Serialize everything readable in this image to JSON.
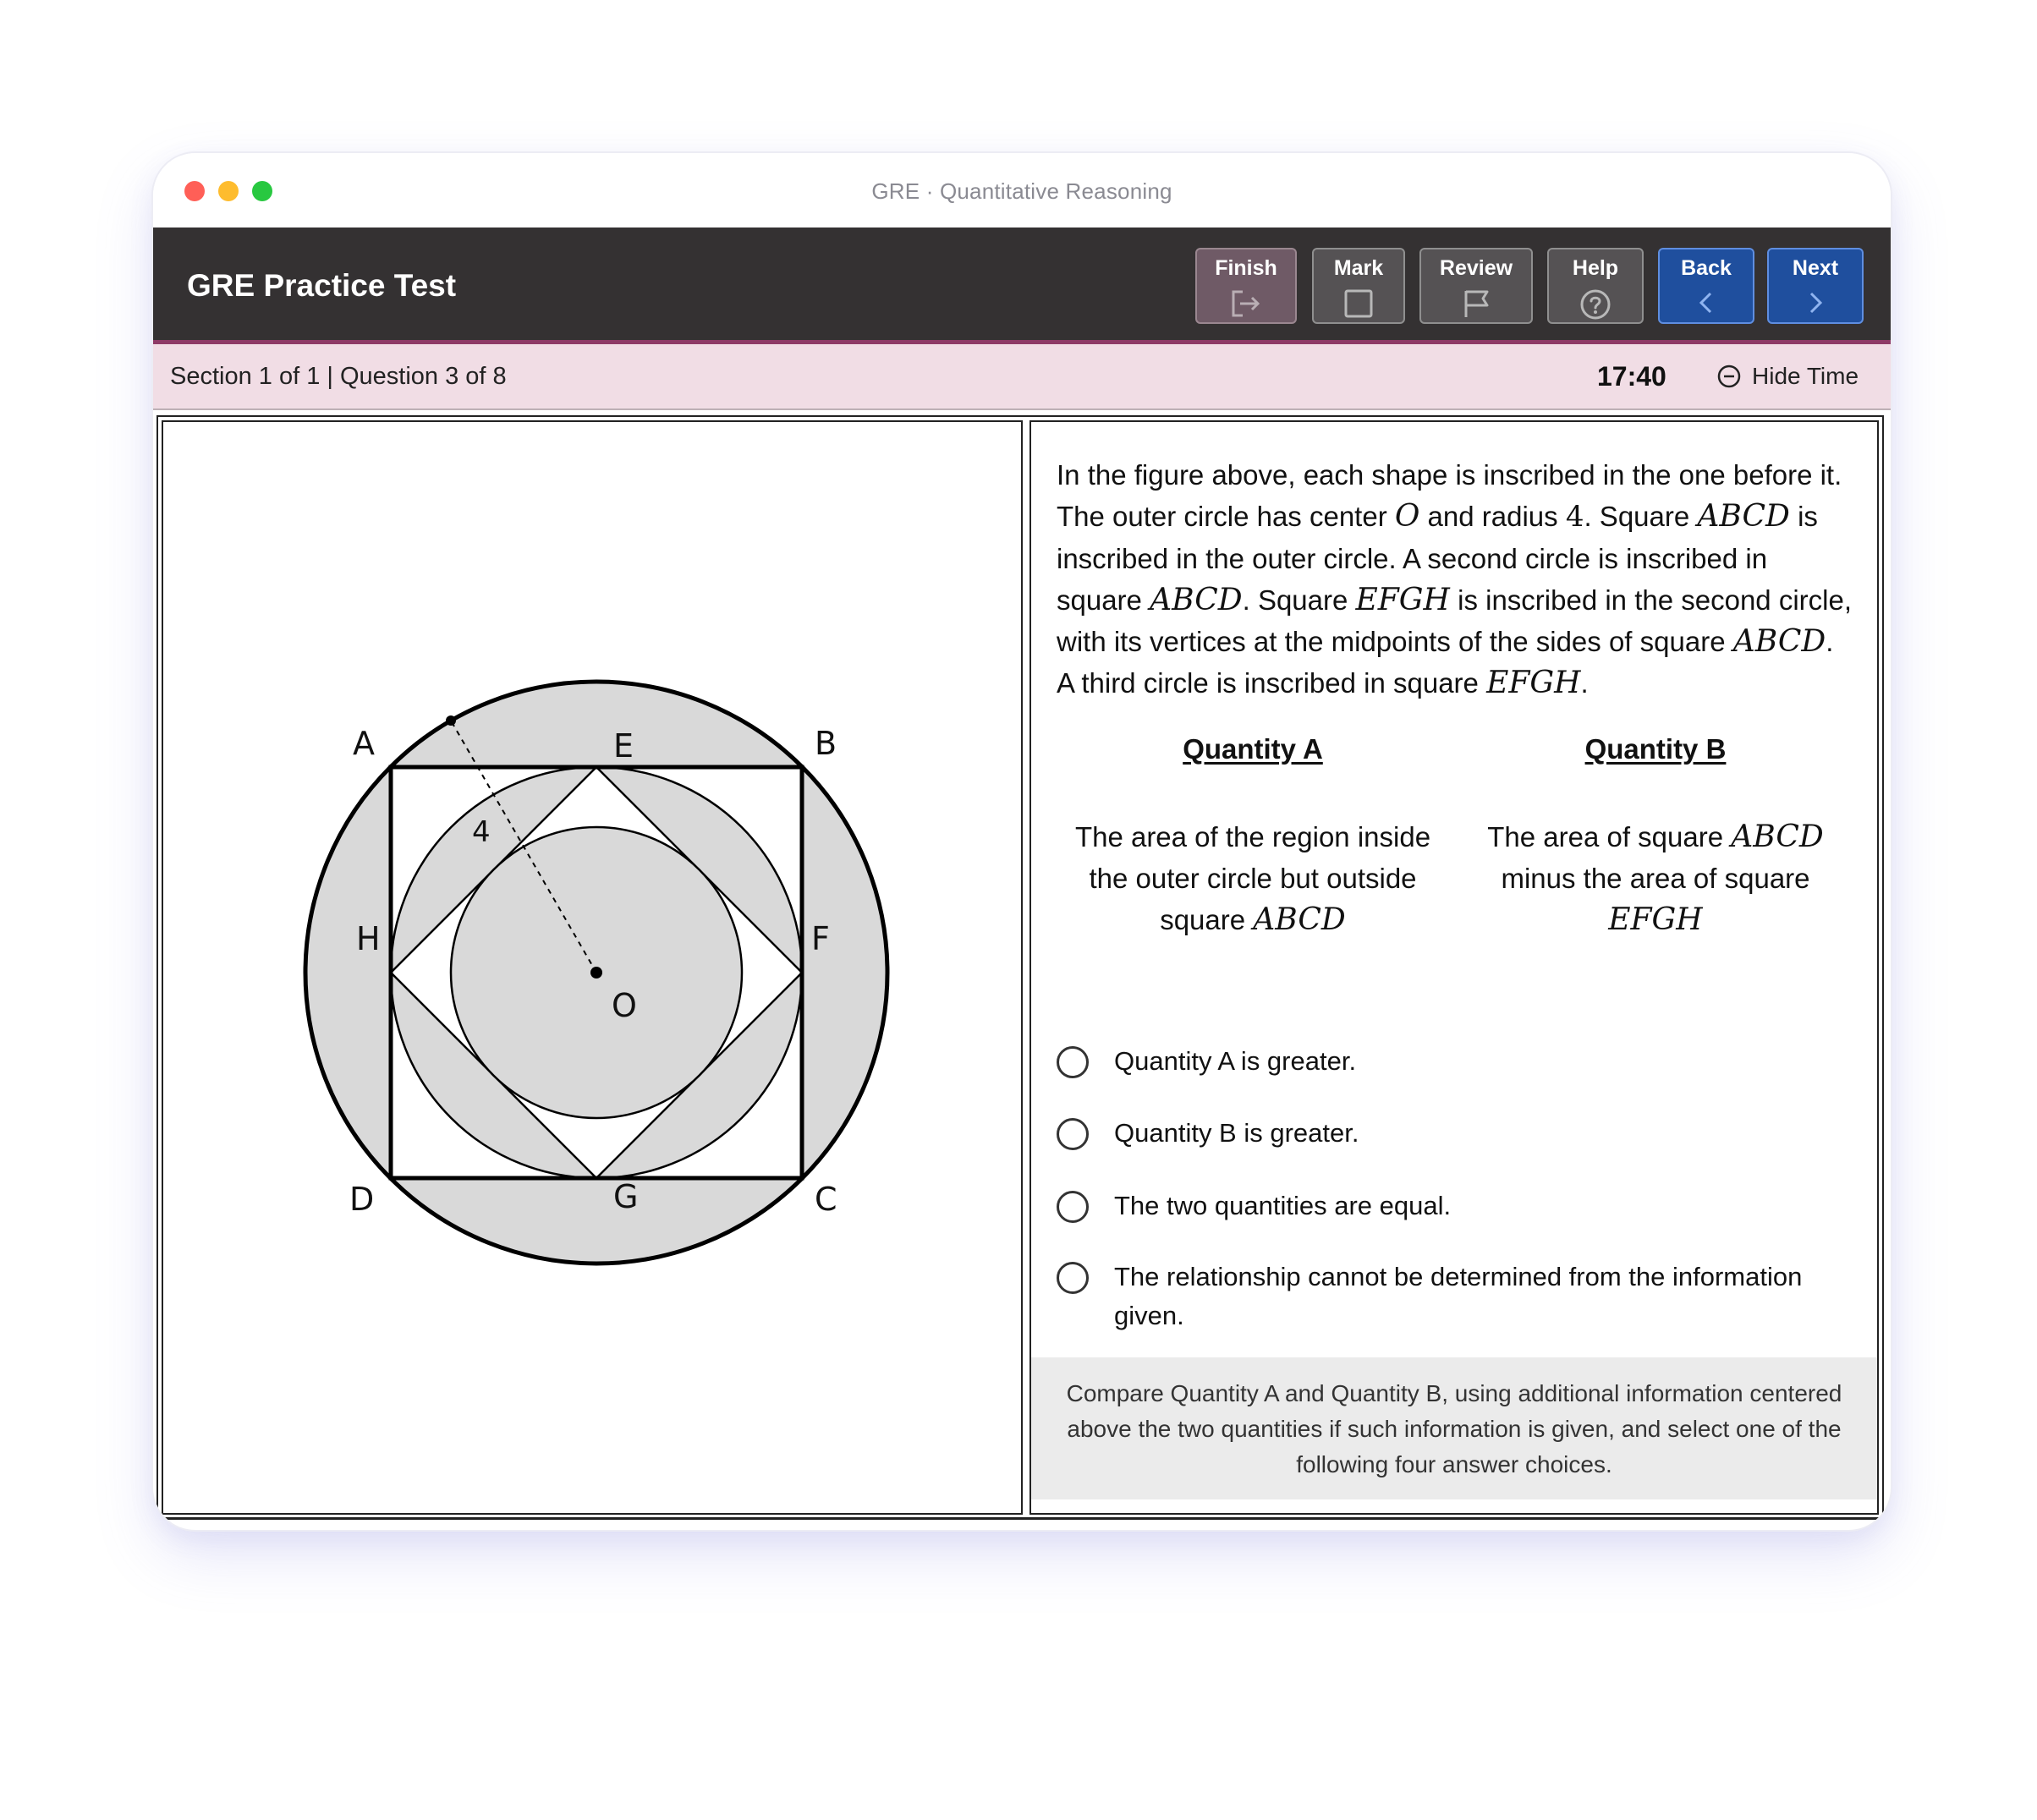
{
  "window": {
    "title": "GRE · Quantitative Reasoning"
  },
  "toolbar": {
    "app_title": "GRE Practice Test",
    "buttons": [
      {
        "label": "Finish",
        "icon": "exit-icon"
      },
      {
        "label": "Mark",
        "icon": "checkbox-icon"
      },
      {
        "label": "Review",
        "icon": "flag-icon"
      },
      {
        "label": "Help",
        "icon": "help-circle-icon"
      },
      {
        "label": "Back",
        "icon": "chevron-left-icon"
      },
      {
        "label": "Next",
        "icon": "chevron-right-icon"
      }
    ]
  },
  "status": {
    "section_info": "Section 1 of 1 | Question 3 of 8",
    "timer": "17:40",
    "hide_time_label": "Hide Time"
  },
  "figure": {
    "labels": {
      "A": "A",
      "B": "B",
      "C": "C",
      "D": "D",
      "E": "E",
      "F": "F",
      "G": "G",
      "H": "H",
      "O": "O",
      "radius": "4"
    }
  },
  "question": {
    "p1": "In the figure above, each shape is inscribed in the one before it. The outer circle has center ",
    "m_O": "O",
    "p2": " and radius ",
    "m_4": "4",
    "p3": ". Square ",
    "m_ABCD_1": "ABCD",
    "p4": " is inscribed in the outer circle. A second circle is inscribed in square ",
    "m_ABCD_2": "ABCD",
    "p5": ". Square ",
    "m_EFGH_1": "EFGH",
    "p6": " is inscribed in the second circle, with its vertices at the midpoints of the sides of square ",
    "m_ABCD_3": "ABCD",
    "p7": ". A third circle is inscribed in square ",
    "m_EFGH_2": "EFGH",
    "p8": "."
  },
  "quantity_a": {
    "heading": "Quantity A",
    "text": "The area of the region inside the outer circle but outside square ",
    "math": "ABCD"
  },
  "quantity_b": {
    "heading": "Quantity B",
    "text1": "The area of square ",
    "math1": "ABCD",
    "text2": " minus the area of square ",
    "math2": "EFGH"
  },
  "options": [
    "Quantity A is greater.",
    "Quantity B is greater.",
    "The two quantities are equal.",
    "The relationship cannot be determined from the information given."
  ],
  "instructions": "Compare Quantity A and Quantity B, using additional information centered above the two quantities if such information is given, and select one of the following four answer choices."
}
